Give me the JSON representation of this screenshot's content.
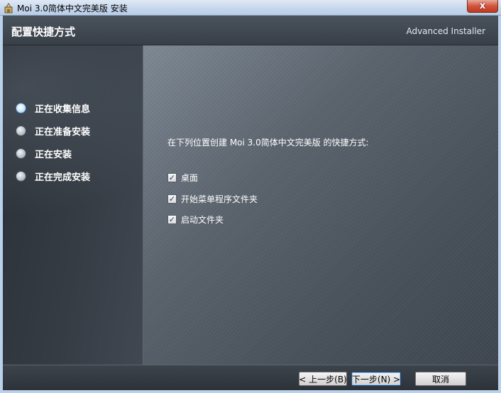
{
  "window": {
    "title": "Moi 3.0简体中文完美版 安装",
    "close_glyph": "x"
  },
  "header": {
    "title": "配置快捷方式",
    "brand": "Advanced Installer"
  },
  "steps": [
    {
      "label": "正在收集信息",
      "active": true
    },
    {
      "label": "正在准备安装",
      "active": false
    },
    {
      "label": "正在安装",
      "active": false
    },
    {
      "label": "正在完成安装",
      "active": false
    }
  ],
  "content": {
    "intro": "在下列位置创建 Moi 3.0简体中文完美版 的快捷方式:",
    "options": [
      {
        "label": "桌面",
        "checked": true
      },
      {
        "label": "开始菜单程序文件夹",
        "checked": true
      },
      {
        "label": "启动文件夹",
        "checked": true
      }
    ],
    "check_glyph": "✓"
  },
  "buttons": {
    "back": "< 上一步(B)",
    "next": "下一步(N) >",
    "cancel": "取消"
  },
  "icons": {
    "app": "installer-app-icon",
    "close": "close-icon"
  }
}
